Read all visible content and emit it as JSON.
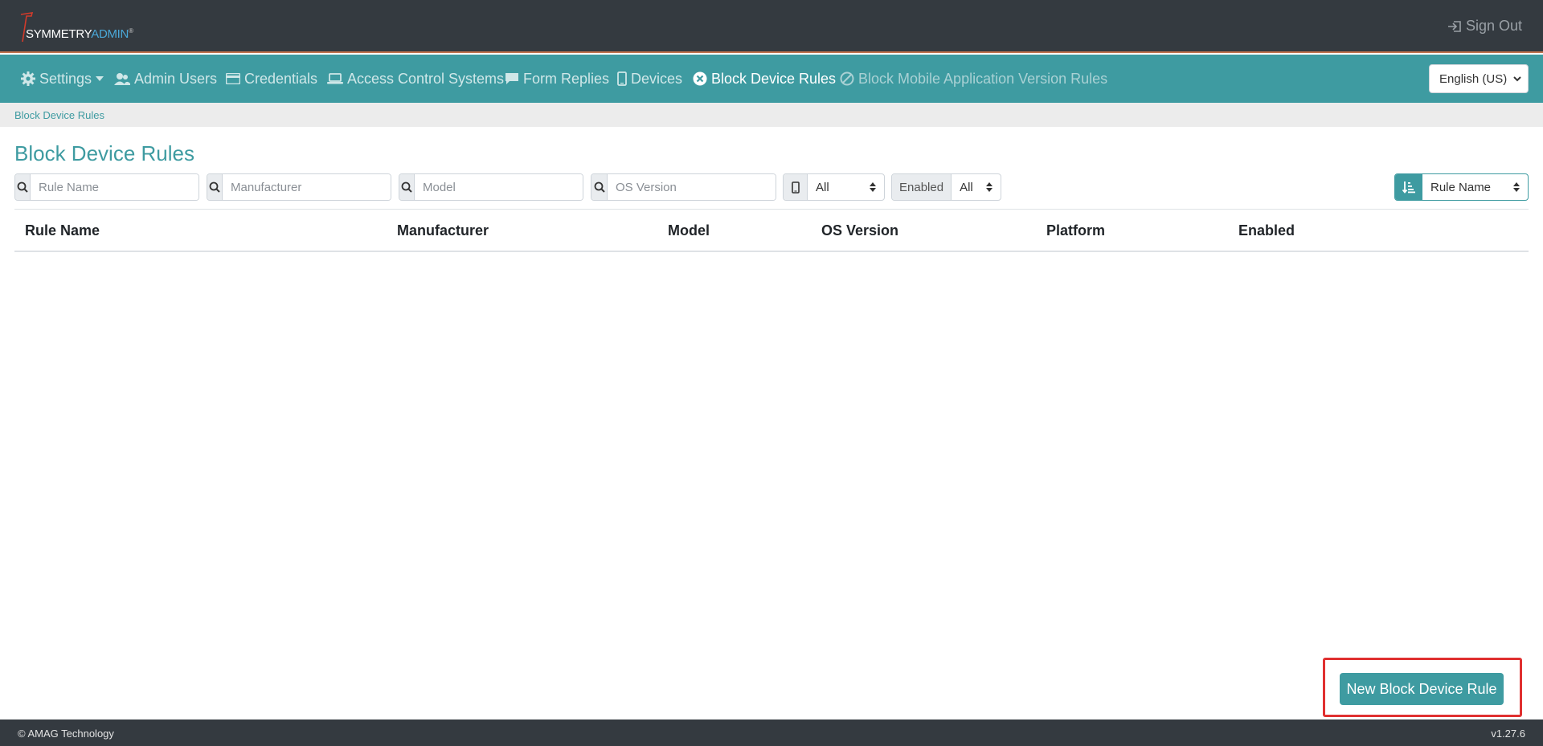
{
  "brand": {
    "name_part1": "SYMMETRY",
    "name_part2": "ADMIN",
    "trademark": "®"
  },
  "header": {
    "sign_out_label": "Sign Out"
  },
  "nav": {
    "items": [
      {
        "label": "Settings",
        "icon": "gear-icon"
      },
      {
        "label": "Admin Users",
        "icon": "users-icon"
      },
      {
        "label": "Credentials",
        "icon": "credential-card-icon"
      },
      {
        "label": "Access Control Systems",
        "icon": "laptop-icon"
      },
      {
        "label": "Form Replies",
        "icon": "comment-icon"
      },
      {
        "label": "Devices",
        "icon": "mobile-icon"
      },
      {
        "label": "Block Device Rules",
        "icon": "circle-x-icon",
        "active": true
      },
      {
        "label": "Block Mobile Application Version Rules",
        "icon": "ban-icon"
      }
    ],
    "language": "English (US)"
  },
  "breadcrumb": {
    "current": "Block Device Rules"
  },
  "page": {
    "title": "Block Device Rules"
  },
  "filters": {
    "rule_name_placeholder": "Rule Name",
    "manufacturer_placeholder": "Manufacturer",
    "model_placeholder": "Model",
    "os_version_placeholder": "OS Version",
    "platform_value": "All",
    "enabled_label": "Enabled",
    "enabled_value": "All",
    "sort_value": "Rule Name"
  },
  "table": {
    "columns": [
      "Rule Name",
      "Manufacturer",
      "Model",
      "OS Version",
      "Platform",
      "Enabled"
    ],
    "rows": []
  },
  "actions": {
    "new_rule_label": "New Block Device Rule"
  },
  "footer": {
    "copyright": "© AMAG Technology",
    "version": "v1.27.6"
  },
  "colors": {
    "teal": "#3e9ba1",
    "dark": "#343a40",
    "highlight": "#e03030",
    "logo_accent": "#4aa8d8"
  }
}
